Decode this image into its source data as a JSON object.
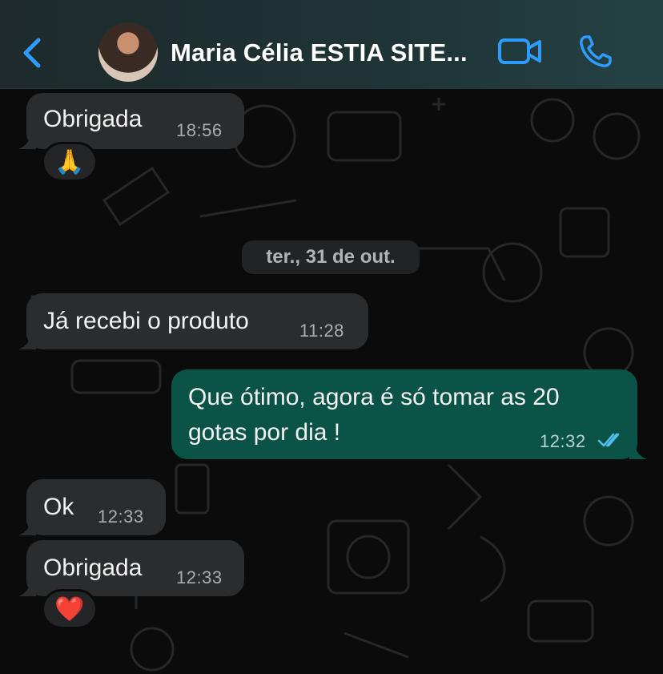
{
  "header": {
    "contact_name": "Maria Célia ESTIA SITE...",
    "icons": {
      "back": "chevron-left-icon",
      "video": "video-camera-icon",
      "call": "phone-icon"
    },
    "accent_color": "#2e9bff"
  },
  "chat": {
    "messages": [
      {
        "direction": "in",
        "text": "Obrigada",
        "time": "18:56",
        "reaction": "🙏"
      },
      {
        "direction": "in",
        "text": "Já recebi o produto",
        "time": "11:28"
      },
      {
        "direction": "out",
        "text_line1": "Que ótimo, agora é só tomar as 20",
        "text_line2": "gotas por dia !",
        "time": "12:32",
        "status": "read"
      },
      {
        "direction": "in",
        "text": "Ok",
        "time": "12:33"
      },
      {
        "direction": "in",
        "text": "Obrigada",
        "time": "12:33",
        "reaction": "❤️"
      }
    ],
    "date_separator": "ter., 31 de out.",
    "colors": {
      "incoming": "#2b2c2d",
      "outgoing": "#0b5347",
      "read_ticks": "#53bdeb"
    }
  }
}
